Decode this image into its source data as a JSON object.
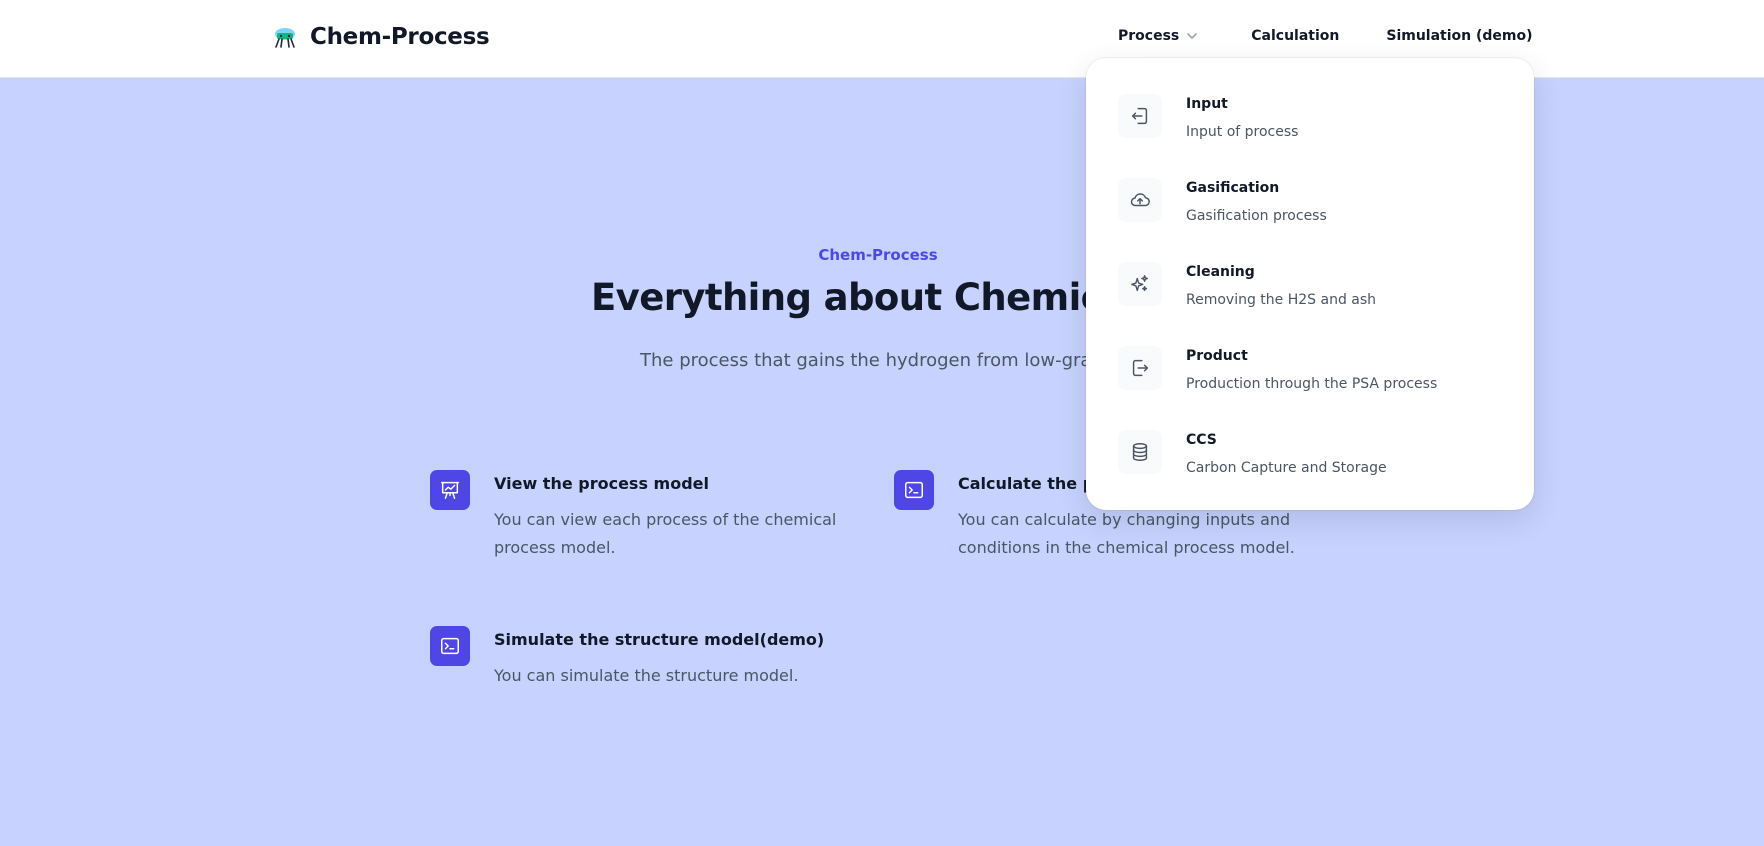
{
  "header": {
    "brand": "Chem-Process",
    "nav": {
      "process": "Process",
      "calculation": "Calculation",
      "simulation": "Simulation (demo)"
    }
  },
  "dropdown": {
    "items": [
      {
        "title": "Input",
        "desc": "Input of process",
        "icon": "login-icon"
      },
      {
        "title": "Gasification",
        "desc": "Gasification process",
        "icon": "cloud-upload-icon"
      },
      {
        "title": "Cleaning",
        "desc": "Removing the H2S and ash",
        "icon": "sparkles-icon"
      },
      {
        "title": "Product",
        "desc": "Production through the PSA process",
        "icon": "logout-icon"
      },
      {
        "title": "CCS",
        "desc": "Carbon Capture and Storage",
        "icon": "database-icon"
      }
    ]
  },
  "hero": {
    "eyebrow": "Chem-Process",
    "headline": "Everything about Chemical Pro",
    "subline": "The process that gains the hydrogen from low-grade c"
  },
  "features": [
    {
      "title": "View the process model",
      "desc": "You can view each process of the chemical process model.",
      "icon": "presentation-chart-icon"
    },
    {
      "title": "Calculate the pro",
      "desc": "You can calculate by changing inputs and conditions in the chemical process model.",
      "icon": "terminal-icon"
    },
    {
      "title": "Simulate the structure model(demo)",
      "desc": "You can simulate the structure model.",
      "icon": "terminal-icon"
    }
  ],
  "colors": {
    "accent": "#4f46e5",
    "background": "#c7d2fe",
    "text": "#111827",
    "muted": "#4b5563"
  }
}
